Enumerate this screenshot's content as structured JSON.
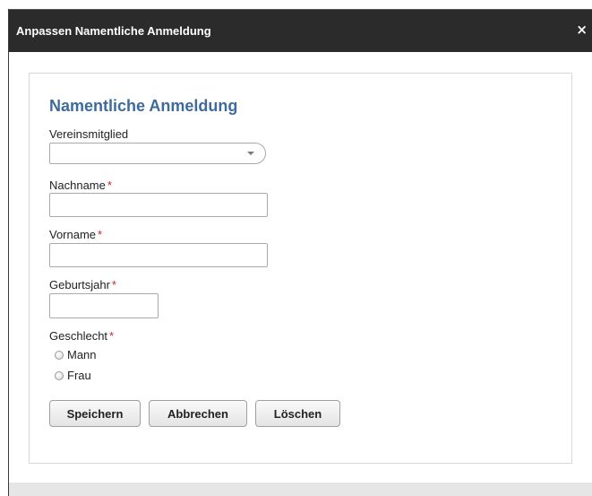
{
  "dialog": {
    "title": "Anpassen Namentliche Anmeldung",
    "close_symbol": "×"
  },
  "form": {
    "heading": "Namentliche Anmeldung",
    "member_label": "Vereinsmitglied",
    "member_value": "",
    "lastname_label": "Nachname",
    "lastname_value": "",
    "firstname_label": "Vorname",
    "firstname_value": "",
    "birthyear_label": "Geburtsjahr",
    "birthyear_value": "",
    "gender_label": "Geschlecht",
    "gender_options": [
      "Mann",
      "Frau"
    ],
    "required_marker": "*"
  },
  "buttons": {
    "save": "Speichern",
    "cancel": "Abbrechen",
    "delete": "Löschen"
  },
  "colors": {
    "titlebar": "#2b2b2b",
    "heading": "#3e6b9b",
    "required": "#d62020"
  }
}
